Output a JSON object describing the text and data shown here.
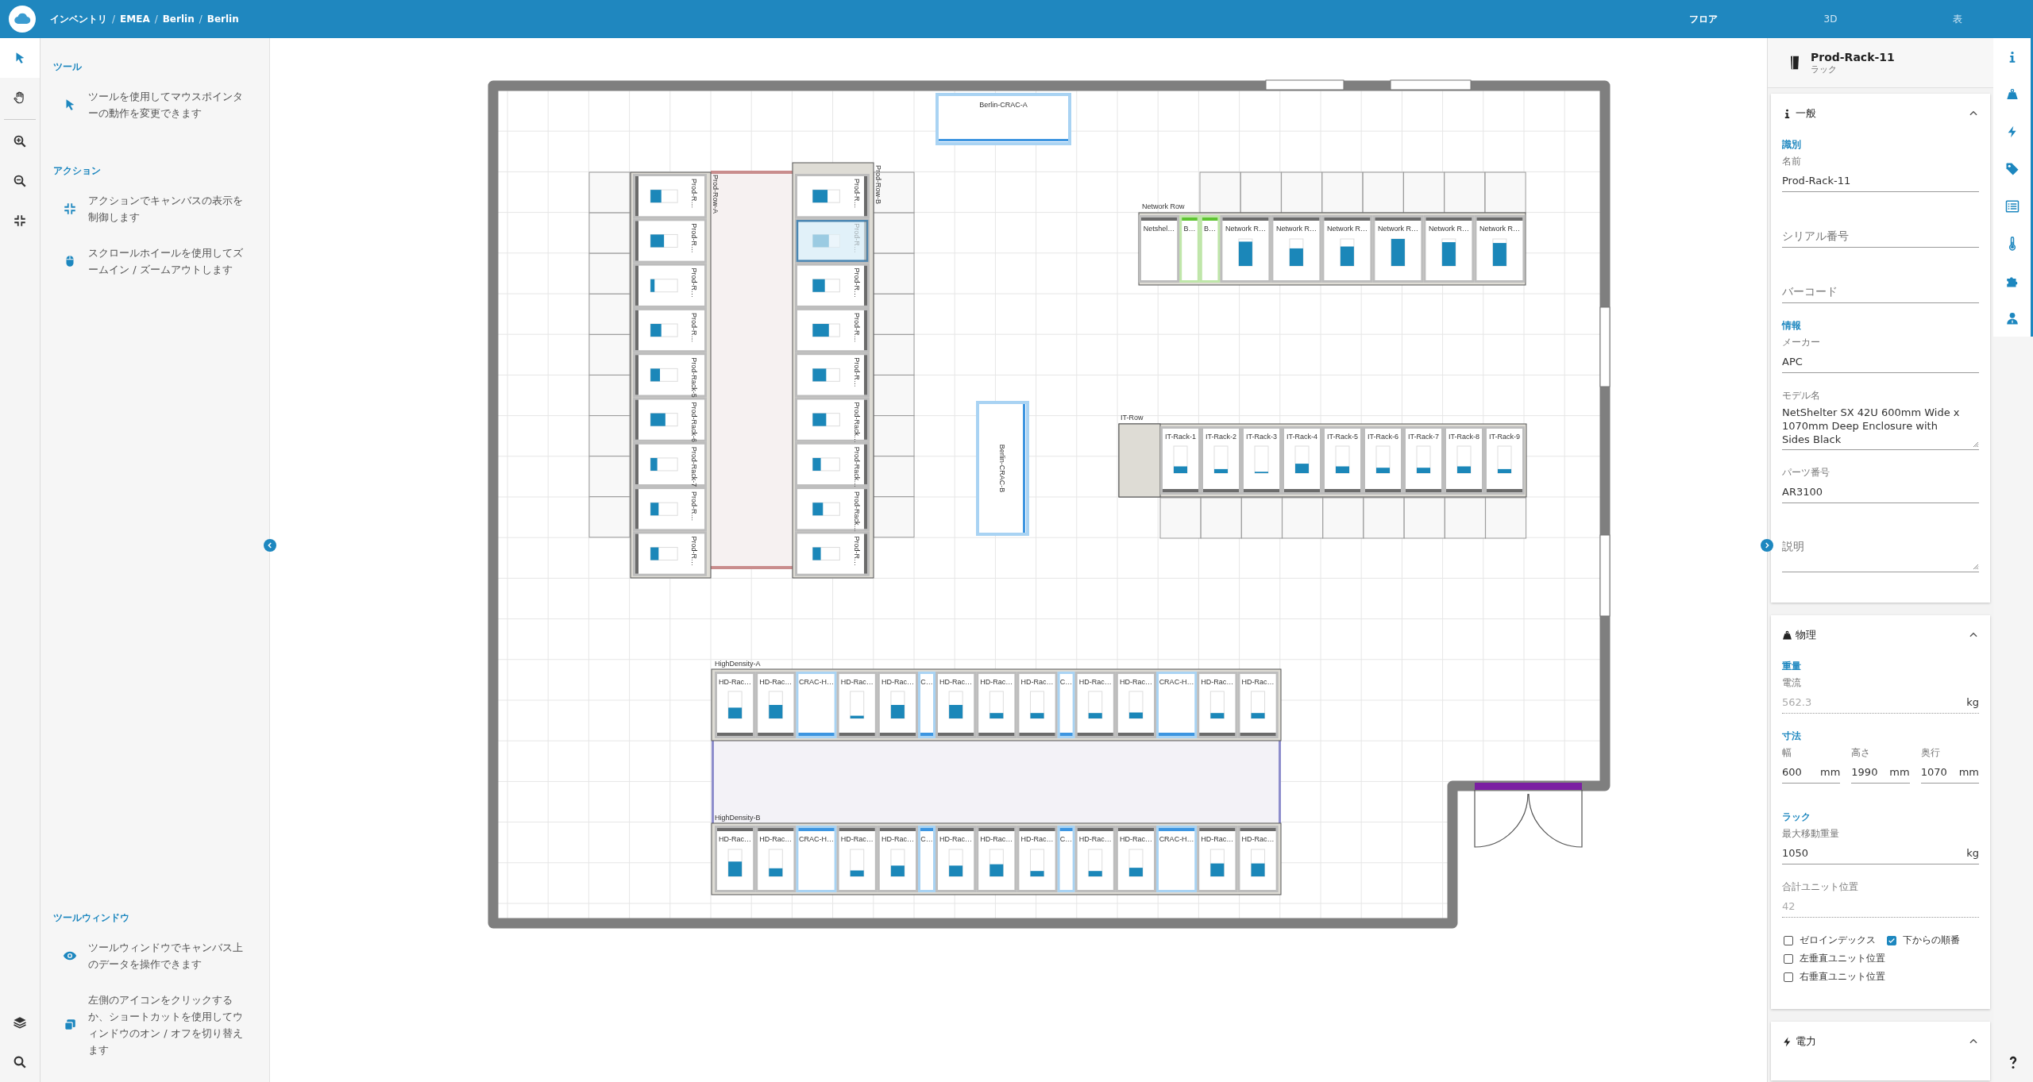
{
  "top_bar": {
    "breadcrumb": [
      "インベントリ",
      "EMEA",
      "Berlin",
      "Berlin"
    ],
    "separator": "/",
    "views": [
      {
        "label": "フロア",
        "selected": true
      },
      {
        "label": "3D",
        "selected": false
      },
      {
        "label": "表",
        "selected": false
      }
    ]
  },
  "tool_rail": {
    "tools": [
      {
        "selected": true
      },
      {
        "selected": false
      }
    ]
  },
  "help_panel": {
    "sections": [
      {
        "heading": "ツール",
        "items": [
          "ツールを使用してマウスポインターの動作を変更できます"
        ]
      },
      {
        "heading": "アクション",
        "items": [
          "アクションでキャンバスの表示を制御します",
          "スクロールホイールを使用してズームイン / ズームアウトします"
        ]
      },
      {
        "heading": "ツールウィンドウ",
        "items": [
          "ツールウィンドウでキャンバス上のデータを操作できます",
          "左側のアイコンをクリックするか、ショートカットを使用してウィンドウのオン / オフを切り替えます"
        ]
      }
    ]
  },
  "floor": {
    "cooling_units": [
      {
        "label": "Berlin-CRAC-A",
        "selected": false
      },
      {
        "label": "Berlin-CRAC-B",
        "selected": false
      }
    ],
    "rows": [
      {
        "name": "Prod-Row-A",
        "racks": [
          {
            "kind": "rack",
            "label": "Prod-R…",
            "level": 0.4,
            "selected": false
          },
          {
            "kind": "rack",
            "label": "Prod-R…",
            "level": 0.5,
            "selected": false
          },
          {
            "kind": "rack",
            "label": "Prod-R…",
            "level": 0.15,
            "selected": false
          },
          {
            "kind": "rack",
            "label": "Prod-R…",
            "level": 0.4,
            "selected": false
          },
          {
            "kind": "rack",
            "label": "Prod-Rack-5",
            "level": 0.35,
            "selected": false
          },
          {
            "kind": "rack",
            "label": "Prod-Rack-6",
            "level": 0.55,
            "selected": false
          },
          {
            "kind": "rack",
            "label": "Prod-Rack-7",
            "level": 0.25,
            "selected": false
          },
          {
            "kind": "rack",
            "label": "Prod-R…",
            "level": 0.3,
            "selected": false
          },
          {
            "kind": "rack",
            "label": "Prod-R…",
            "level": 0.3,
            "selected": false
          }
        ]
      },
      {
        "name": "Prod-Row-B",
        "racks": [
          {
            "kind": "rack",
            "label": "Prod-R…",
            "level": 0.55,
            "selected": false
          },
          {
            "kind": "rack",
            "label": "Prod-R…",
            "level": 0.6,
            "selected": true
          },
          {
            "kind": "rack",
            "label": "Prod-R…",
            "level": 0.45,
            "selected": false
          },
          {
            "kind": "rack",
            "label": "Prod-R…",
            "level": 0.6,
            "selected": false
          },
          {
            "kind": "rack",
            "label": "Prod-R…",
            "level": 0.5,
            "selected": false
          },
          {
            "kind": "rack",
            "label": "Prod-Rack…",
            "level": 0.5,
            "selected": false
          },
          {
            "kind": "rack",
            "label": "Prod-Rack…",
            "level": 0.3,
            "selected": false
          },
          {
            "kind": "rack",
            "label": "Prod-Rack…",
            "level": 0.38,
            "selected": false
          },
          {
            "kind": "rack",
            "label": "Prod-R…",
            "level": 0.3,
            "selected": false
          }
        ]
      },
      {
        "name": "Network Row",
        "racks": [
          {
            "kind": "enclosure",
            "label": "Netshel…",
            "selected": false
          },
          {
            "kind": "blank",
            "label": "B…",
            "selected": false
          },
          {
            "kind": "blank",
            "label": "B…",
            "selected": false
          },
          {
            "kind": "rack",
            "label": "Network R…",
            "level": 0.9,
            "selected": false
          },
          {
            "kind": "rack",
            "label": "Network R…",
            "level": 0.65,
            "selected": false
          },
          {
            "kind": "rack",
            "label": "Network R…",
            "level": 0.72,
            "selected": false
          },
          {
            "kind": "rack",
            "label": "Network R…",
            "level": 1,
            "selected": false
          },
          {
            "kind": "rack",
            "label": "Network R…",
            "level": 0.88,
            "selected": false
          },
          {
            "kind": "rack",
            "label": "Network R…",
            "level": 0.85,
            "selected": false
          }
        ]
      },
      {
        "name": "IT-Row",
        "racks": [
          {
            "kind": "rack",
            "label": "IT-Rack-1",
            "level": 0.25,
            "selected": false
          },
          {
            "kind": "rack",
            "label": "IT-Rack-2",
            "level": 0.15,
            "selected": false
          },
          {
            "kind": "rack",
            "label": "IT-Rack-3",
            "level": 0.05,
            "selected": false
          },
          {
            "kind": "rack",
            "label": "IT-Rack-4",
            "level": 0.35,
            "selected": false
          },
          {
            "kind": "rack",
            "label": "IT-Rack-5",
            "level": 0.25,
            "selected": false
          },
          {
            "kind": "rack",
            "label": "IT-Rack-6",
            "level": 0.2,
            "selected": false
          },
          {
            "kind": "rack",
            "label": "IT-Rack-7",
            "level": 0.2,
            "selected": false
          },
          {
            "kind": "rack",
            "label": "IT-Rack-8",
            "level": 0.25,
            "selected": false
          },
          {
            "kind": "rack",
            "label": "IT-Rack-9",
            "level": 0.15,
            "selected": false
          }
        ]
      },
      {
        "name": "HighDensity-A",
        "racks": [
          {
            "kind": "rack",
            "label": "HD-Rac…",
            "level": 0.4,
            "selected": false
          },
          {
            "kind": "rack",
            "label": "HD-Rac…",
            "level": 0.5,
            "selected": false
          },
          {
            "kind": "crac",
            "label": "CRAC-H…",
            "selected": false
          },
          {
            "kind": "rack",
            "label": "HD-Rac…",
            "level": 0.1,
            "selected": false
          },
          {
            "kind": "rack",
            "label": "HD-Rac…",
            "level": 0.5,
            "selected": false
          },
          {
            "kind": "cooler",
            "label": "C…",
            "selected": false
          },
          {
            "kind": "rack",
            "label": "HD-Rac…",
            "level": 0.5,
            "selected": false
          },
          {
            "kind": "rack",
            "label": "HD-Rac…",
            "level": 0.2,
            "selected": false
          },
          {
            "kind": "rack",
            "label": "HD-Rac…",
            "level": 0.2,
            "selected": false
          },
          {
            "kind": "cooler",
            "label": "C…",
            "selected": false
          },
          {
            "kind": "rack",
            "label": "HD-Rac…",
            "level": 0.2,
            "selected": false
          },
          {
            "kind": "rack",
            "label": "HD-Rac…",
            "level": 0.22,
            "selected": false
          },
          {
            "kind": "crac",
            "label": "CRAC-H…",
            "selected": false
          },
          {
            "kind": "rack",
            "label": "HD-Rac…",
            "level": 0.2,
            "selected": false
          },
          {
            "kind": "rack",
            "label": "HD-Rac…",
            "level": 0.2,
            "selected": false
          }
        ]
      },
      {
        "name": "HighDensity-B",
        "racks": [
          {
            "kind": "rack",
            "label": "HD-Rac…",
            "level": 0.55,
            "selected": false
          },
          {
            "kind": "rack",
            "label": "HD-Rac…",
            "level": 0.3,
            "selected": false
          },
          {
            "kind": "crac",
            "label": "CRAC-H…",
            "selected": false
          },
          {
            "kind": "rack",
            "label": "HD-Rac…",
            "level": 0.22,
            "selected": false
          },
          {
            "kind": "rack",
            "label": "HD-Rac…",
            "level": 0.4,
            "selected": false
          },
          {
            "kind": "cooler",
            "label": "C…",
            "selected": false
          },
          {
            "kind": "rack",
            "label": "HD-Rac…",
            "level": 0.4,
            "selected": false
          },
          {
            "kind": "rack",
            "label": "HD-Rac…",
            "level": 0.45,
            "selected": false
          },
          {
            "kind": "rack",
            "label": "HD-Rac…",
            "level": 0.2,
            "selected": false
          },
          {
            "kind": "cooler",
            "label": "C…",
            "selected": false
          },
          {
            "kind": "rack",
            "label": "HD-Rac…",
            "level": 0.2,
            "selected": false
          },
          {
            "kind": "rack",
            "label": "HD-Rac…",
            "level": 0.32,
            "selected": false
          },
          {
            "kind": "crac",
            "label": "CRAC-H…",
            "selected": false
          },
          {
            "kind": "rack",
            "label": "HD-Rac…",
            "level": 0.48,
            "selected": false
          },
          {
            "kind": "rack",
            "label": "HD-Rac…",
            "level": 0.48,
            "selected": false
          }
        ]
      }
    ]
  },
  "inspector": {
    "title": "Prod-Rack-11",
    "subtitle": "ラック",
    "cards": [
      {
        "title": "一般",
        "expanded": true,
        "groups": [
          {
            "heading": "識別",
            "fields": [
              {
                "kind": "text",
                "label": "名前",
                "value": "Prod-Rack-11"
              },
              {
                "kind": "text",
                "placeholder": "シリアル番号"
              },
              {
                "kind": "text",
                "placeholder": "バーコード"
              }
            ]
          },
          {
            "heading": "情報",
            "fields": [
              {
                "kind": "text",
                "label": "メーカー",
                "value": "APC"
              },
              {
                "kind": "textarea",
                "label": "モデル名",
                "value": "NetShelter SX 42U 600mm Wide x 1070mm Deep Enclosure with Sides Black"
              },
              {
                "kind": "text",
                "label": "パーツ番号",
                "value": "AR3100"
              },
              {
                "kind": "textarea",
                "placeholder": "説明"
              }
            ]
          }
        ]
      },
      {
        "title": "物理",
        "expanded": true,
        "groups": [
          {
            "heading": "重量",
            "fields": [
              {
                "kind": "text",
                "label": "電流",
                "value": "562.3",
                "unit": "kg",
                "disabled": true
              }
            ]
          },
          {
            "heading": "寸法",
            "kind": "inline",
            "fields": [
              {
                "kind": "text",
                "label": "幅",
                "value": "600",
                "unit": "mm"
              },
              {
                "kind": "text",
                "label": "高さ",
                "value": "1990",
                "unit": "mm"
              },
              {
                "kind": "text",
                "label": "奥行",
                "value": "1070",
                "unit": "mm"
              }
            ]
          },
          {
            "heading": "ラック",
            "fields": [
              {
                "kind": "text",
                "label": "最大移動重量",
                "value": "1050",
                "unit": "kg"
              },
              {
                "kind": "text",
                "label": "合計ユニット位置",
                "value": "42",
                "disabled": true
              }
            ],
            "checkbox_rows": [
              [
                {
                  "label": "ゼロインデックス",
                  "checked": false
                },
                {
                  "label": "下からの順番",
                  "checked": true
                }
              ],
              [
                {
                  "label": "左垂直ユニット位置",
                  "checked": false
                }
              ],
              [
                {
                  "label": "右垂直ユニット位置",
                  "checked": false
                }
              ]
            ]
          }
        ]
      },
      {
        "title": "電力",
        "expanded": true
      }
    ]
  }
}
